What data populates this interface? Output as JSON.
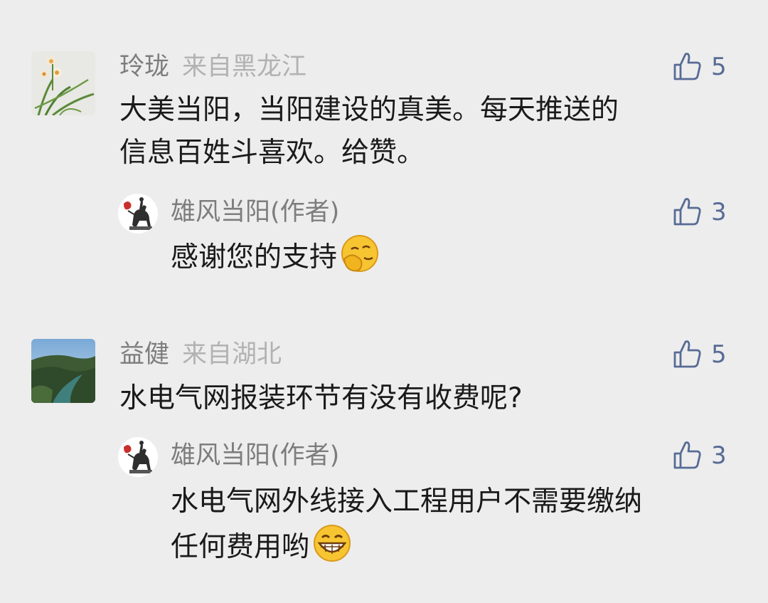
{
  "comments": [
    {
      "name": "玲珑",
      "location": "来自黑龙江",
      "likes": "5",
      "avatar_icon": "orchid-flower-icon",
      "text_lines": [
        "大美当阳，当阳建设的真美。每天推送的",
        "信息百姓斗喜欢。给赞。"
      ],
      "reply": {
        "name": "雄风当阳(作者)",
        "likes": "3",
        "avatar_icon": "horse-rider-statue-icon",
        "text_lines": [
          "感谢您的支持"
        ],
        "emoji": "shy-smile-emoji"
      }
    },
    {
      "name": "益健",
      "location": "来自湖北",
      "likes": "5",
      "avatar_icon": "river-valley-icon",
      "text_lines": [
        "水电气网报装环节有没有收费呢?"
      ],
      "reply": {
        "name": "雄风当阳(作者)",
        "likes": "3",
        "avatar_icon": "horse-rider-statue-icon",
        "text_lines": [
          "水电气网外线接入工程用户不需要缴纳",
          "任何费用哟"
        ],
        "emoji": "grin-emoji"
      }
    }
  ],
  "colors": {
    "background": "#ededed",
    "nickname": "#7d7d7d",
    "location": "#b2b2b2",
    "like_blue": "#576b95",
    "text": "#1a1a1a"
  }
}
